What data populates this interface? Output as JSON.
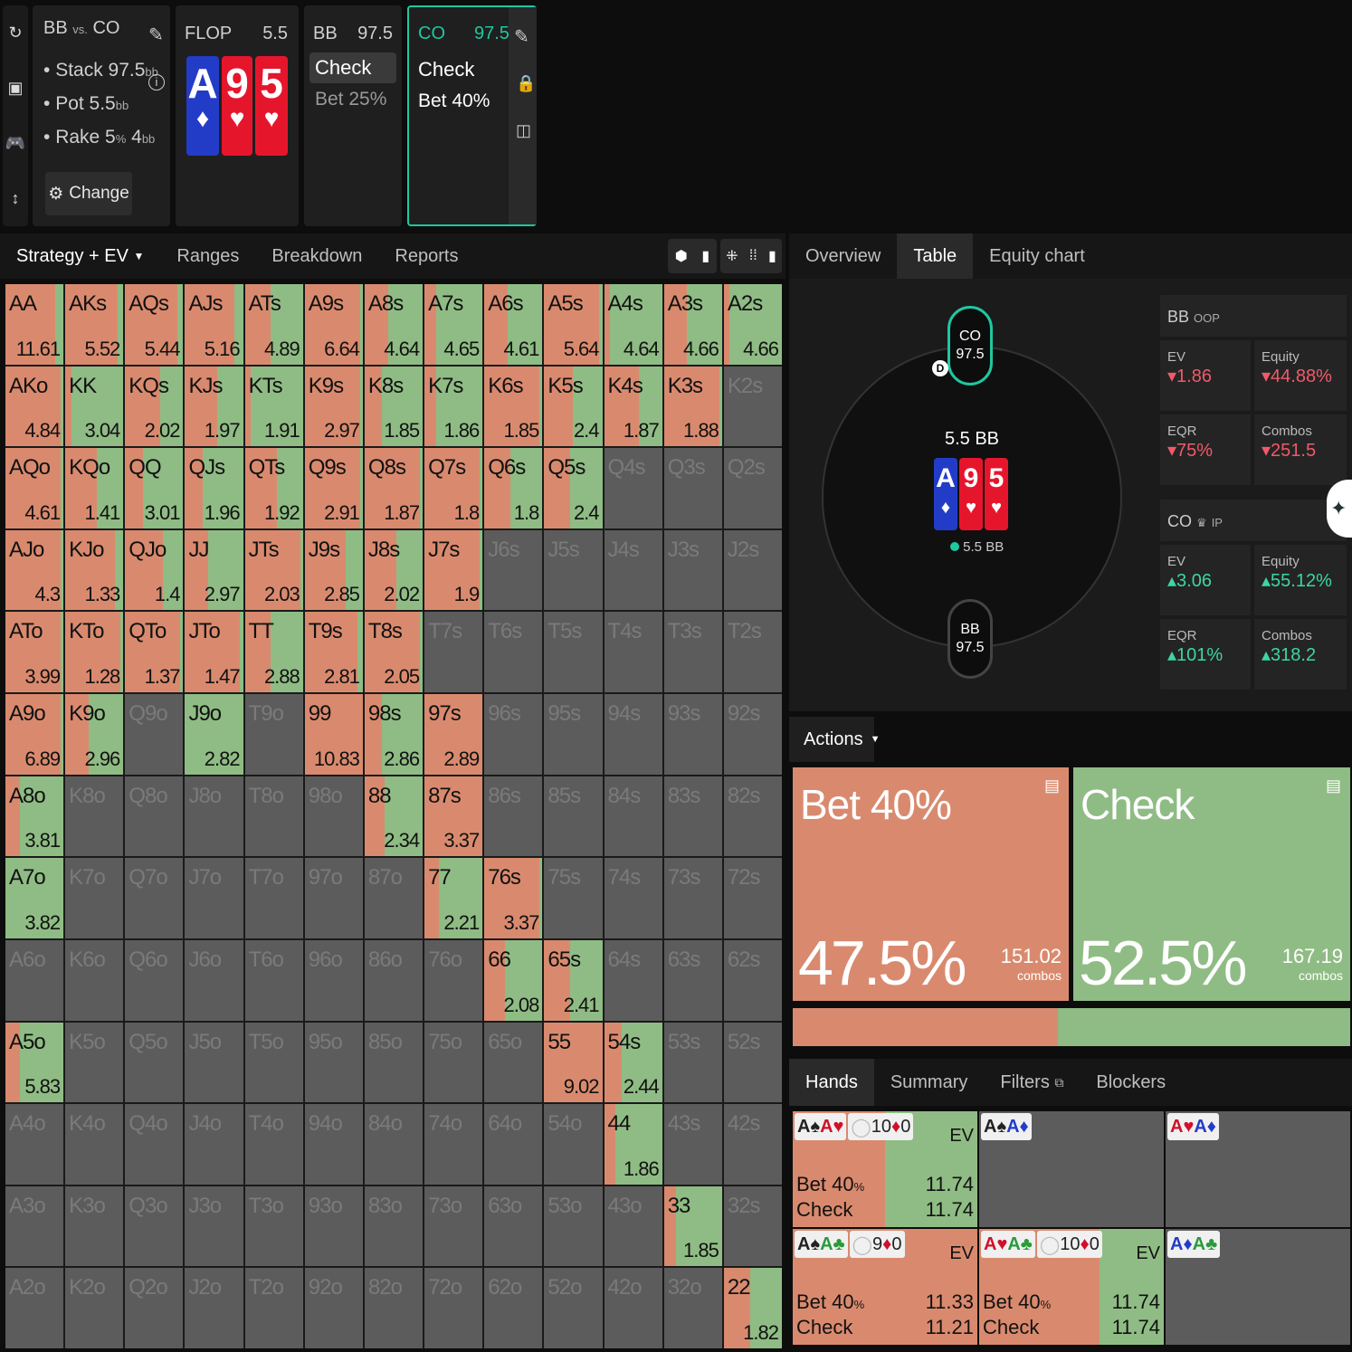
{
  "toolbar_icons": [
    "undo-icon",
    "save-icon",
    "gamepad-icon",
    "resize-icon"
  ],
  "spot": {
    "title_left": "BB",
    "title_vs": "vs.",
    "title_right": "CO",
    "stack": "Stack 97.5",
    "stack_unit": "bb",
    "pot": "Pot 5.5",
    "pot_unit": "bb",
    "rake": "Rake 5",
    "rake_pct": "%",
    "rake_cap": "4",
    "rake_unit": "bb",
    "change_label": "Change"
  },
  "flop": {
    "label": "FLOP",
    "pot": "5.5",
    "cards": [
      {
        "rank": "A",
        "suit": "♦",
        "color": "blue"
      },
      {
        "rank": "9",
        "suit": "♥",
        "color": "red"
      },
      {
        "rank": "5",
        "suit": "♥",
        "color": "red"
      }
    ]
  },
  "bb_node": {
    "label": "BB",
    "stack": "97.5",
    "actions": [
      "Check",
      "Bet 25%"
    ]
  },
  "co_node": {
    "label": "CO",
    "stack": "97.5",
    "actions": [
      "Check",
      "Bet 40%"
    ]
  },
  "left_tabs": [
    "Strategy + EV",
    "Ranges",
    "Breakdown",
    "Reports"
  ],
  "right_tabs": [
    "Overview",
    "Table",
    "Equity chart"
  ],
  "table": {
    "co_seat": {
      "name": "CO",
      "stack": "97.5"
    },
    "bb_seat": {
      "name": "BB",
      "stack": "97.5"
    },
    "dealer": "D",
    "pot": "5.5 BB",
    "chips": "5.5 BB",
    "bb_panel": {
      "name": "BB",
      "pos": "OOP",
      "ev_label": "EV",
      "ev": "1.86",
      "equity_label": "Equity",
      "equity": "44.88%",
      "eqr_label": "EQR",
      "eqr": "75%",
      "combos_label": "Combos",
      "combos": "251.5"
    },
    "co_panel": {
      "name": "CO",
      "pos": "IP",
      "ev_label": "EV",
      "ev": "3.06",
      "equity_label": "Equity",
      "equity": "55.12%",
      "eqr_label": "EQR",
      "eqr": "101%",
      "combos_label": "Combos",
      "combos": "318.2"
    }
  },
  "actions": {
    "label": "Actions",
    "bet": {
      "name": "Bet 40%",
      "pct": "47.5%",
      "combos": "151.02",
      "combos_label": "combos",
      "color": "#d98a6e"
    },
    "check": {
      "name": "Check",
      "pct": "52.5%",
      "combos": "167.19",
      "combos_label": "combos",
      "color": "#8fbc84"
    },
    "bar_split": 0.475
  },
  "hands_tabs": [
    "Hands",
    "Summary",
    "Filters",
    "Blockers"
  ],
  "hands": [
    {
      "cards": "A♠A♥",
      "card_colors": [
        "#222",
        "#d0102a"
      ],
      "blockers": [
        {
          "r": "10",
          "s": "♦"
        },
        {
          "r": "0",
          "s": ""
        }
      ],
      "ev_label": "EV",
      "bet_label": "Bet 40",
      "bet_pct": "%",
      "bet_ev": "11.74",
      "check_label": "Check",
      "check_ev": "11.74",
      "bet_frac": 0.5
    },
    {
      "cards": "A♠A♦",
      "card_colors": [
        "#222",
        "#233cc8"
      ],
      "empty": true
    },
    {
      "cards": "A♥A♦",
      "card_colors": [
        "#d0102a",
        "#233cc8"
      ],
      "empty": true
    },
    {
      "cards": "A♠A♣",
      "card_colors": [
        "#222",
        "#2a9a3a"
      ],
      "blockers": [
        {
          "r": "9",
          "s": "♦"
        },
        {
          "r": "0",
          "s": ""
        }
      ],
      "ev_label": "EV",
      "bet_label": "Bet 40",
      "bet_pct": "%",
      "bet_ev": "11.33",
      "check_label": "Check",
      "check_ev": "11.21",
      "bet_frac": 1.0
    },
    {
      "cards": "A♥A♣",
      "card_colors": [
        "#d0102a",
        "#2a9a3a"
      ],
      "blockers": [
        {
          "r": "10",
          "s": "♦"
        },
        {
          "r": "0",
          "s": ""
        }
      ],
      "ev_label": "EV",
      "bet_label": "Bet 40",
      "bet_pct": "%",
      "bet_ev": "11.74",
      "check_label": "Check",
      "check_ev": "11.74",
      "bet_frac": 0.65
    },
    {
      "cards": "A♦A♣",
      "card_colors": [
        "#233cc8",
        "#2a9a3a"
      ],
      "empty": true
    }
  ],
  "matrix": [
    [
      [
        "AA",
        0.85,
        "11.61"
      ],
      [
        "AKs",
        0.9,
        "5.52"
      ],
      [
        "AQs",
        0.9,
        "5.44"
      ],
      [
        "AJs",
        0.85,
        "5.16"
      ],
      [
        "ATs",
        0.45,
        "4.89"
      ],
      [
        "A9s",
        0.95,
        "6.64"
      ],
      [
        "A8s",
        0.4,
        "4.64"
      ],
      [
        "A7s",
        0.2,
        "4.65"
      ],
      [
        "A6s",
        0.4,
        "4.61"
      ],
      [
        "A5s",
        0.95,
        "5.64"
      ],
      [
        "A4s",
        0.1,
        "4.64"
      ],
      [
        "A3s",
        0.4,
        "4.66"
      ],
      [
        "A2s",
        0.1,
        "4.66"
      ]
    ],
    [
      [
        "AKo",
        0.95,
        "4.84"
      ],
      [
        "KK",
        0.1,
        "3.04"
      ],
      [
        "KQs",
        0.6,
        "2.02"
      ],
      [
        "KJs",
        0.55,
        "1.97"
      ],
      [
        "KTs",
        0.1,
        "1.91"
      ],
      [
        "K9s",
        0.95,
        "2.97"
      ],
      [
        "K8s",
        0.3,
        "1.85"
      ],
      [
        "K7s",
        0.2,
        "1.86"
      ],
      [
        "K6s",
        0.95,
        "1.85"
      ],
      [
        "K5s",
        0.5,
        "2.4"
      ],
      [
        "K4s",
        0.6,
        "1.87"
      ],
      [
        "K3s",
        0.95,
        "1.88"
      ],
      [
        "K2s",
        null,
        ""
      ]
    ],
    [
      [
        "AQo",
        0.95,
        "4.61"
      ],
      [
        "KQo",
        0.55,
        "1.41"
      ],
      [
        "QQ",
        0.3,
        "3.01"
      ],
      [
        "QJs",
        0.3,
        "1.96"
      ],
      [
        "QTs",
        0.55,
        "1.92"
      ],
      [
        "Q9s",
        0.95,
        "2.91"
      ],
      [
        "Q8s",
        0.95,
        "1.87"
      ],
      [
        "Q7s",
        0.95,
        "1.8"
      ],
      [
        "Q6s",
        0.45,
        "1.8"
      ],
      [
        "Q5s",
        0.45,
        "2.4"
      ],
      [
        "Q4s",
        null,
        ""
      ],
      [
        "Q3s",
        null,
        ""
      ],
      [
        "Q2s",
        null,
        ""
      ]
    ],
    [
      [
        "AJo",
        0.95,
        "4.3"
      ],
      [
        "KJo",
        0.85,
        "1.33"
      ],
      [
        "QJo",
        0.65,
        "1.4"
      ],
      [
        "JJ",
        0.4,
        "2.97"
      ],
      [
        "JTs",
        0.95,
        "2.03"
      ],
      [
        "J9s",
        0.7,
        "2.85"
      ],
      [
        "J8s",
        0.55,
        "2.02"
      ],
      [
        "J7s",
        0.95,
        "1.9"
      ],
      [
        "J6s",
        null,
        ""
      ],
      [
        "J5s",
        null,
        ""
      ],
      [
        "J4s",
        null,
        ""
      ],
      [
        "J3s",
        null,
        ""
      ],
      [
        "J2s",
        null,
        ""
      ]
    ],
    [
      [
        "ATo",
        0.95,
        "3.99"
      ],
      [
        "KTo",
        0.95,
        "1.28"
      ],
      [
        "QTo",
        0.95,
        "1.37"
      ],
      [
        "JTo",
        0.95,
        "1.47"
      ],
      [
        "TT",
        0.45,
        "2.88"
      ],
      [
        "T9s",
        0.9,
        "2.81"
      ],
      [
        "T8s",
        0.95,
        "2.05"
      ],
      [
        "T7s",
        null,
        ""
      ],
      [
        "T6s",
        null,
        ""
      ],
      [
        "T5s",
        null,
        ""
      ],
      [
        "T4s",
        null,
        ""
      ],
      [
        "T3s",
        null,
        ""
      ],
      [
        "T2s",
        null,
        ""
      ]
    ],
    [
      [
        "A9o",
        0.95,
        "6.89"
      ],
      [
        "K9o",
        0.4,
        "2.96"
      ],
      [
        "Q9o",
        null,
        ""
      ],
      [
        "J9o",
        0.0,
        "2.82"
      ],
      [
        "T9o",
        null,
        ""
      ],
      [
        "99",
        1.0,
        "10.83"
      ],
      [
        "98s",
        0.3,
        "2.86"
      ],
      [
        "97s",
        1.0,
        "2.89"
      ],
      [
        "96s",
        null,
        ""
      ],
      [
        "95s",
        null,
        ""
      ],
      [
        "94s",
        null,
        ""
      ],
      [
        "93s",
        null,
        ""
      ],
      [
        "92s",
        null,
        ""
      ]
    ],
    [
      [
        "A8o",
        0.25,
        "3.81"
      ],
      [
        "K8o",
        null,
        ""
      ],
      [
        "Q8o",
        null,
        ""
      ],
      [
        "J8o",
        null,
        ""
      ],
      [
        "T8o",
        null,
        ""
      ],
      [
        "98o",
        null,
        ""
      ],
      [
        "88",
        0.35,
        "2.34"
      ],
      [
        "87s",
        1.0,
        "3.37"
      ],
      [
        "86s",
        null,
        ""
      ],
      [
        "85s",
        null,
        ""
      ],
      [
        "84s",
        null,
        ""
      ],
      [
        "83s",
        null,
        ""
      ],
      [
        "82s",
        null,
        ""
      ]
    ],
    [
      [
        "A7o",
        0.0,
        "3.82"
      ],
      [
        "K7o",
        null,
        ""
      ],
      [
        "Q7o",
        null,
        ""
      ],
      [
        "J7o",
        null,
        ""
      ],
      [
        "T7o",
        null,
        ""
      ],
      [
        "97o",
        null,
        ""
      ],
      [
        "87o",
        null,
        ""
      ],
      [
        "77",
        0.25,
        "2.21"
      ],
      [
        "76s",
        0.95,
        "3.37"
      ],
      [
        "75s",
        null,
        ""
      ],
      [
        "74s",
        null,
        ""
      ],
      [
        "73s",
        null,
        ""
      ],
      [
        "72s",
        null,
        ""
      ]
    ],
    [
      [
        "A6o",
        null,
        ""
      ],
      [
        "K6o",
        null,
        ""
      ],
      [
        "Q6o",
        null,
        ""
      ],
      [
        "J6o",
        null,
        ""
      ],
      [
        "T6o",
        null,
        ""
      ],
      [
        "96o",
        null,
        ""
      ],
      [
        "86o",
        null,
        ""
      ],
      [
        "76o",
        null,
        ""
      ],
      [
        "66",
        0.35,
        "2.08"
      ],
      [
        "65s",
        0.45,
        "2.41"
      ],
      [
        "64s",
        null,
        ""
      ],
      [
        "63s",
        null,
        ""
      ],
      [
        "62s",
        null,
        ""
      ]
    ],
    [
      [
        "A5o",
        0.25,
        "5.83"
      ],
      [
        "K5o",
        null,
        ""
      ],
      [
        "Q5o",
        null,
        ""
      ],
      [
        "J5o",
        null,
        ""
      ],
      [
        "T5o",
        null,
        ""
      ],
      [
        "95o",
        null,
        ""
      ],
      [
        "85o",
        null,
        ""
      ],
      [
        "75o",
        null,
        ""
      ],
      [
        "65o",
        null,
        ""
      ],
      [
        "55",
        1.0,
        "9.02"
      ],
      [
        "54s",
        0.3,
        "2.44"
      ],
      [
        "53s",
        null,
        ""
      ],
      [
        "52s",
        null,
        ""
      ]
    ],
    [
      [
        "A4o",
        null,
        ""
      ],
      [
        "K4o",
        null,
        ""
      ],
      [
        "Q4o",
        null,
        ""
      ],
      [
        "J4o",
        null,
        ""
      ],
      [
        "T4o",
        null,
        ""
      ],
      [
        "94o",
        null,
        ""
      ],
      [
        "84o",
        null,
        ""
      ],
      [
        "74o",
        null,
        ""
      ],
      [
        "64o",
        null,
        ""
      ],
      [
        "54o",
        null,
        ""
      ],
      [
        "44",
        0.2,
        "1.86"
      ],
      [
        "43s",
        null,
        ""
      ],
      [
        "42s",
        null,
        ""
      ]
    ],
    [
      [
        "A3o",
        null,
        ""
      ],
      [
        "K3o",
        null,
        ""
      ],
      [
        "Q3o",
        null,
        ""
      ],
      [
        "J3o",
        null,
        ""
      ],
      [
        "T3o",
        null,
        ""
      ],
      [
        "93o",
        null,
        ""
      ],
      [
        "83o",
        null,
        ""
      ],
      [
        "73o",
        null,
        ""
      ],
      [
        "63o",
        null,
        ""
      ],
      [
        "53o",
        null,
        ""
      ],
      [
        "43o",
        null,
        ""
      ],
      [
        "33",
        0.2,
        "1.85"
      ],
      [
        "32s",
        null,
        ""
      ]
    ],
    [
      [
        "A2o",
        null,
        ""
      ],
      [
        "K2o",
        null,
        ""
      ],
      [
        "Q2o",
        null,
        ""
      ],
      [
        "J2o",
        null,
        ""
      ],
      [
        "T2o",
        null,
        ""
      ],
      [
        "92o",
        null,
        ""
      ],
      [
        "82o",
        null,
        ""
      ],
      [
        "72o",
        null,
        ""
      ],
      [
        "62o",
        null,
        ""
      ],
      [
        "52o",
        null,
        ""
      ],
      [
        "42o",
        null,
        ""
      ],
      [
        "32o",
        null,
        ""
      ],
      [
        "22",
        0.45,
        "1.82"
      ]
    ]
  ],
  "colors": {
    "bet": "#d98a6e",
    "check": "#8fbc84",
    "accent": "#1ec8a0",
    "empty": "#5c5c5c"
  }
}
